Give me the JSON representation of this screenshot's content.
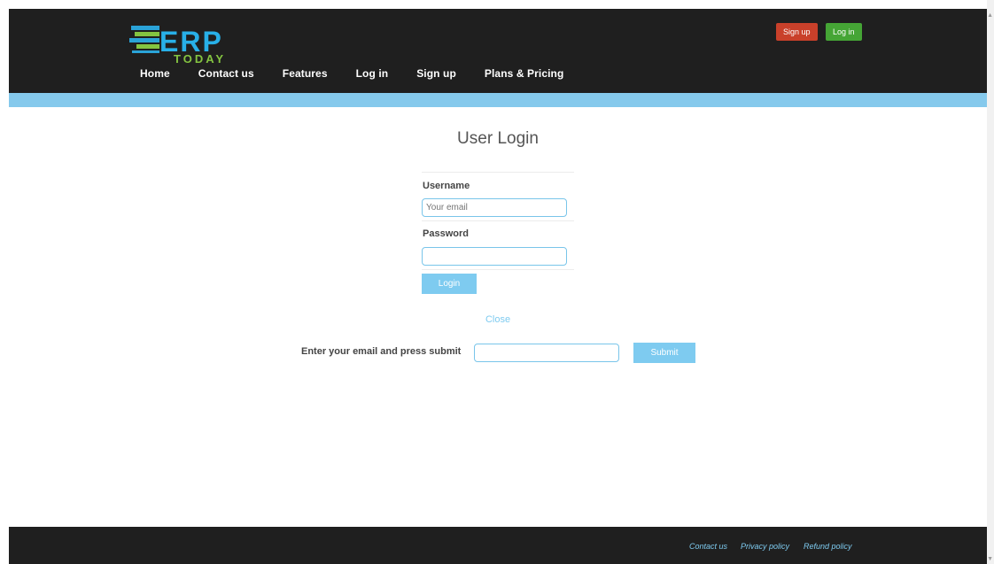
{
  "logo": {
    "text": "ERP",
    "subtext": "TODAY"
  },
  "header": {
    "nav": [
      "Home",
      "Contact us",
      "Features",
      "Log in",
      "Sign up",
      "Plans & Pricing"
    ],
    "signup_label": "Sign up",
    "login_label": "Log in"
  },
  "login": {
    "title": "User Login",
    "username_label": "Username",
    "username_placeholder": "Your email",
    "password_label": "Password",
    "button": "Login",
    "close": "Close"
  },
  "reset": {
    "label": "Enter your email and press submit",
    "button": "Submit"
  },
  "footer": {
    "links": [
      "Contact us",
      "Privacy policy",
      "Refund policy"
    ]
  },
  "colors": {
    "header_bg": "#1f1f1f",
    "accent_blue": "#7ecbf0",
    "strip_blue": "#85c9ec",
    "signup_red": "#c9402a",
    "login_green": "#45a535"
  }
}
